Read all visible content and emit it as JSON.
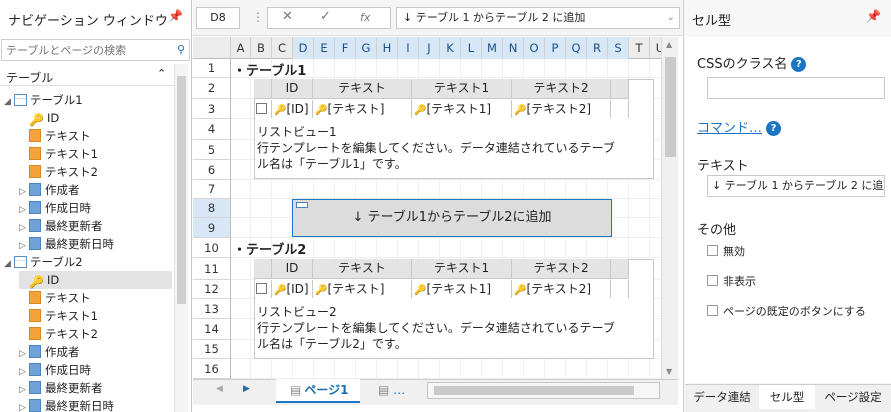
{
  "nav": {
    "title": "ナビゲーション ウィンドウ",
    "search_placeholder": "テーブルとページの検索",
    "section": "テーブル",
    "tree": [
      {
        "label": "テーブル1",
        "kind": "table",
        "expanded": true,
        "depth": 0
      },
      {
        "label": "ID",
        "kind": "key",
        "depth": 1
      },
      {
        "label": "テキスト",
        "kind": "field",
        "depth": 1
      },
      {
        "label": "テキスト1",
        "kind": "field",
        "depth": 1
      },
      {
        "label": "テキスト2",
        "kind": "field",
        "depth": 1
      },
      {
        "label": "作成者",
        "kind": "field-blue",
        "collapsed": true,
        "depth": 1
      },
      {
        "label": "作成日時",
        "kind": "field-blue",
        "collapsed": true,
        "depth": 1
      },
      {
        "label": "最終更新者",
        "kind": "field-blue",
        "collapsed": true,
        "depth": 1
      },
      {
        "label": "最終更新日時",
        "kind": "field-blue",
        "collapsed": true,
        "depth": 1
      },
      {
        "label": "テーブル2",
        "kind": "table",
        "expanded": true,
        "depth": 0
      },
      {
        "label": "ID",
        "kind": "key",
        "depth": 1,
        "selected": true
      },
      {
        "label": "テキスト",
        "kind": "field",
        "depth": 1
      },
      {
        "label": "テキスト1",
        "kind": "field",
        "depth": 1
      },
      {
        "label": "テキスト2",
        "kind": "field",
        "depth": 1
      },
      {
        "label": "作成者",
        "kind": "field-blue",
        "collapsed": true,
        "depth": 1
      },
      {
        "label": "作成日時",
        "kind": "field-blue",
        "collapsed": true,
        "depth": 1
      },
      {
        "label": "最終更新者",
        "kind": "field-blue",
        "collapsed": true,
        "depth": 1
      },
      {
        "label": "最終更新日時",
        "kind": "field-blue",
        "collapsed": true,
        "depth": 1
      }
    ]
  },
  "toolbar": {
    "cell_ref": "D8",
    "cancel_icon": "✕",
    "accept_icon": "✓",
    "fx_icon": "fx",
    "formula": "↓ テーブル 1 からテーブル 2 に追加"
  },
  "grid": {
    "columns": [
      "A",
      "B",
      "C",
      "D",
      "E",
      "F",
      "G",
      "H",
      "I",
      "J",
      "K",
      "L",
      "M",
      "N",
      "O",
      "P",
      "Q",
      "R",
      "S",
      "T",
      "U"
    ],
    "selected_columns": [
      "D",
      "E",
      "F",
      "G",
      "H",
      "I",
      "J",
      "K",
      "L",
      "M",
      "N",
      "O",
      "P",
      "Q",
      "R",
      "S"
    ],
    "rows": [
      "1",
      "2",
      "3",
      "4",
      "5",
      "6",
      "7",
      "8",
      "9",
      "10",
      "11",
      "12",
      "13",
      "14",
      "15",
      "16"
    ],
    "selected_rows": [
      "8",
      "9"
    ],
    "section1_title": "・テーブル1",
    "section2_title": "・テーブル2",
    "table_headers": [
      "ID",
      "テキスト",
      "テキスト1",
      "テキスト2"
    ],
    "table_cells": [
      "[ID]",
      "[テキスト]",
      "[テキスト1]",
      "[テキスト2]"
    ],
    "listview1": {
      "title": "リストビュー1",
      "line1": "行テンプレートを編集してください。データ連結されているテーブ",
      "line2": "ル名は「テーブル1」です。"
    },
    "listview2": {
      "title": "リストビュー2",
      "line1": "行テンプレートを編集してください。データ連結されているテーブ",
      "line2": "ル名は「テーブル2」です。"
    },
    "button_label": "↓  テーブル1からテーブル2に追加"
  },
  "tabs": {
    "page": "ページ1",
    "more": "…"
  },
  "panel": {
    "title": "セル型",
    "css_label": "CSSのクラス名",
    "css_value": "",
    "command_link": "コマンド…",
    "text_label": "テキスト",
    "text_value": "↓ テーブル 1 からテーブル 2 に追加",
    "other_label": "その他",
    "checkboxes": [
      "無効",
      "非表示",
      "ページの既定のボタンにする"
    ],
    "bottom_tabs": [
      "データ連結",
      "セル型",
      "ページ設定"
    ],
    "active_tab": "セル型"
  },
  "colors": {
    "accent": "#1b74c6",
    "selection": "#d7e7f6",
    "header_bg": "#e4e4e4"
  }
}
